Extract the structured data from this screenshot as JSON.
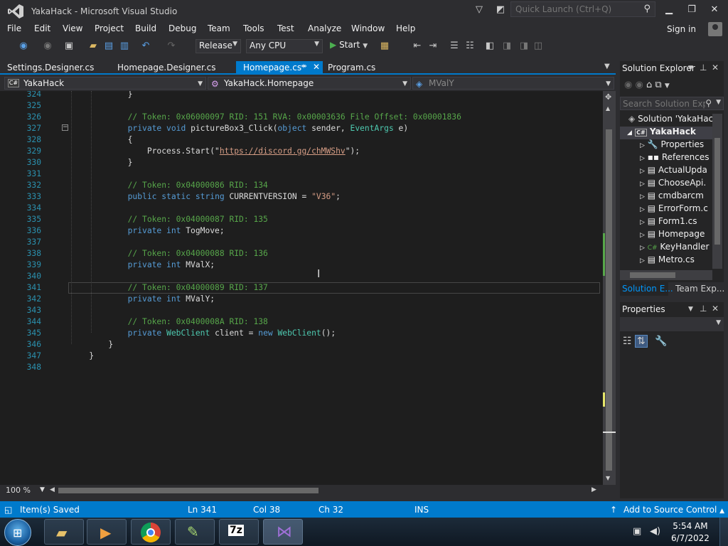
{
  "window": {
    "title": "YakaHack - Microsoft Visual Studio"
  },
  "quick_launch": {
    "placeholder": "Quick Launch (Ctrl+Q)"
  },
  "menu": [
    "File",
    "Edit",
    "View",
    "Project",
    "Build",
    "Debug",
    "Team",
    "Tools",
    "Test",
    "Analyze",
    "Window",
    "Help"
  ],
  "signin": "Sign in",
  "toolbar": {
    "configuration": "Release",
    "platform": "Any CPU",
    "start_label": "Start"
  },
  "tabs": [
    {
      "label": "Settings.Designer.cs",
      "active": false
    },
    {
      "label": "Homepage.Designer.cs",
      "active": false
    },
    {
      "label": "Homepage.cs*",
      "active": true
    },
    {
      "label": "Program.cs",
      "active": false
    }
  ],
  "navbar": {
    "project": "YakaHack",
    "type": "YakaHack.Homepage",
    "member": "MValY"
  },
  "editor": {
    "lines": [
      {
        "n": "324",
        "t": "            }"
      },
      {
        "n": "325",
        "t": ""
      },
      {
        "n": "326",
        "t": "            // Token: 0x06000097 RID: 151 RVA: 0x00003636 File Offset: 0x00001836"
      },
      {
        "n": "327",
        "t": "            private void pictureBox3_Click(object sender, EventArgs e)"
      },
      {
        "n": "328",
        "t": "            {"
      },
      {
        "n": "329",
        "t": "                Process.Start(\"https://discord.gg/chMWShv\");"
      },
      {
        "n": "330",
        "t": "            }"
      },
      {
        "n": "331",
        "t": ""
      },
      {
        "n": "332",
        "t": "            // Token: 0x04000086 RID: 134"
      },
      {
        "n": "333",
        "t": "            public static string CURRENTVERSION = \"V36\";"
      },
      {
        "n": "334",
        "t": ""
      },
      {
        "n": "335",
        "t": "            // Token: 0x04000087 RID: 135"
      },
      {
        "n": "336",
        "t": "            private int TogMove;"
      },
      {
        "n": "337",
        "t": ""
      },
      {
        "n": "338",
        "t": "            // Token: 0x04000088 RID: 136"
      },
      {
        "n": "339",
        "t": "            private int MValX;"
      },
      {
        "n": "340",
        "t": ""
      },
      {
        "n": "341",
        "t": "            // Token: 0x04000089 RID: 137"
      },
      {
        "n": "342",
        "t": "            private int MValY;"
      },
      {
        "n": "343",
        "t": ""
      },
      {
        "n": "344",
        "t": "            // Token: 0x0400008A RID: 138"
      },
      {
        "n": "345",
        "t": "            private WebClient client = new WebClient();"
      },
      {
        "n": "346",
        "t": "        }"
      },
      {
        "n": "347",
        "t": "    }"
      },
      {
        "n": "348",
        "t": ""
      }
    ],
    "zoom": "100 %"
  },
  "solution_explorer": {
    "title": "Solution Explorer",
    "search_placeholder": "Search Solution Expl",
    "items": [
      {
        "label": "Solution 'YakaHac",
        "indent": 0,
        "icon": "solution-icon"
      },
      {
        "label": "YakaHack",
        "indent": 1,
        "icon": "csharp-project-icon",
        "bold": true
      },
      {
        "label": "Properties",
        "indent": 2,
        "icon": "wrench-icon"
      },
      {
        "label": "References",
        "indent": 2,
        "icon": "references-icon"
      },
      {
        "label": "ActualUpda",
        "indent": 2,
        "icon": "form-icon"
      },
      {
        "label": "ChooseApi.",
        "indent": 2,
        "icon": "form-icon"
      },
      {
        "label": "cmdbarcm",
        "indent": 2,
        "icon": "form-icon"
      },
      {
        "label": "ErrorForm.c",
        "indent": 2,
        "icon": "form-icon"
      },
      {
        "label": "Form1.cs",
        "indent": 2,
        "icon": "form-icon"
      },
      {
        "label": "Homepage",
        "indent": 2,
        "icon": "form-icon"
      },
      {
        "label": "KeyHandler",
        "indent": 2,
        "icon": "csharp-file-icon"
      },
      {
        "label": "Metro.cs",
        "indent": 2,
        "icon": "form-icon"
      }
    ],
    "bottom_tabs": [
      "Solution E...",
      "Team Exp..."
    ]
  },
  "properties": {
    "title": "Properties"
  },
  "status": {
    "message": "Item(s) Saved",
    "ln": "Ln 341",
    "col": "Col 38",
    "ch": "Ch 32",
    "mode": "INS",
    "source_control": "Add to Source Control"
  },
  "taskbar": {
    "time": "5:54 AM",
    "date": "6/7/2022"
  },
  "colors": {
    "accent": "#007acc",
    "background": "#1e1e1e",
    "chrome": "#2d2d30"
  }
}
